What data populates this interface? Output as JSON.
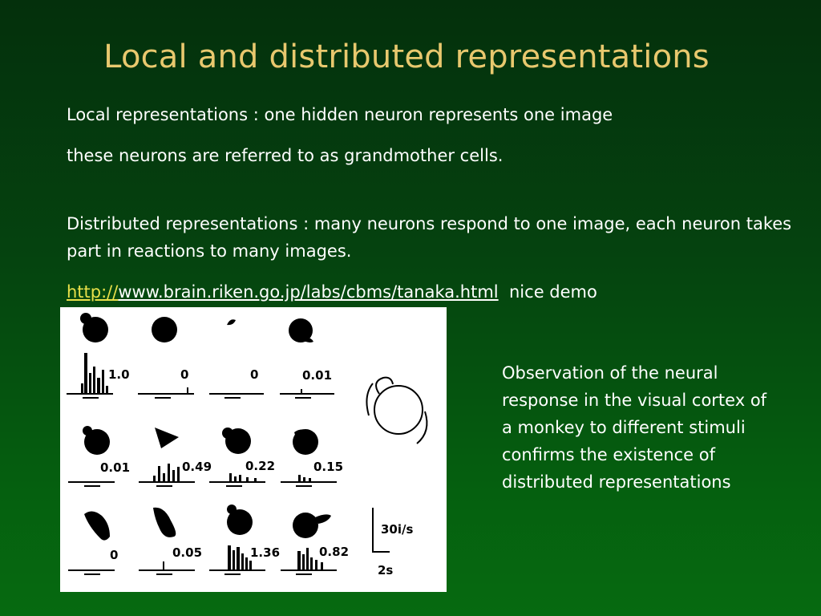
{
  "slide": {
    "title": "Local and distributed representations",
    "paragraph_1": "Local representations : one hidden neuron represents one image",
    "paragraph_2": "these neurons are referred to as grandmother cells.",
    "paragraph_3": "Distributed representations : many neurons respond to one image, each neuron takes part in reactions to many images.",
    "link_prefix": "http://",
    "link_main": "www.brain.riken.go.jp/labs/cbms/tanaka.html",
    "link_suffix": "nice demo",
    "caption": "Observation of the neural response in the visual cortex of a monkey to different stimuli confirms the existence of distributed representations"
  },
  "figure": {
    "responses": [
      "1.0",
      "0",
      "0",
      "0.01",
      "0.01",
      "0.49",
      "0.22",
      "0.15",
      "0",
      "0.05",
      "1.36",
      "0.82"
    ],
    "scale_rate": "30i/s",
    "scale_time": "2s"
  },
  "colors": {
    "title": "#e8c86e",
    "body_text": "#ffffff",
    "link_prefix": "#e8e04a",
    "background_top": "#04300c",
    "background_bottom": "#066a10"
  }
}
